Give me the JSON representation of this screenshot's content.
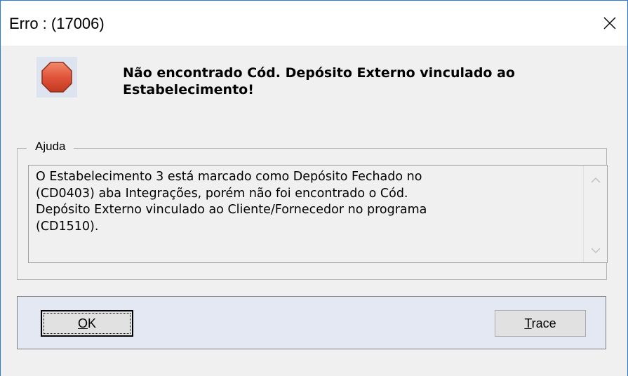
{
  "window": {
    "title": "Erro : (17006)"
  },
  "message": {
    "headline": "Não encontrado Cód. Depósito Externo vinculado ao Estabelecimento!",
    "icon": "stop-icon",
    "icon_color": "#e0543a"
  },
  "help": {
    "legend": "Ajuda",
    "text": "O Estabelecimento 3 está marcado como Depósito Fechado no\n(CD0403) aba Integrações, porém não foi encontrado o Cód.\nDepósito Externo vinculado ao Cliente/Fornecedor no programa\n(CD1510)."
  },
  "buttons": {
    "ok_mnemonic": "O",
    "ok_rest": "K",
    "trace_mnemonic": "T",
    "trace_rest": "race"
  }
}
